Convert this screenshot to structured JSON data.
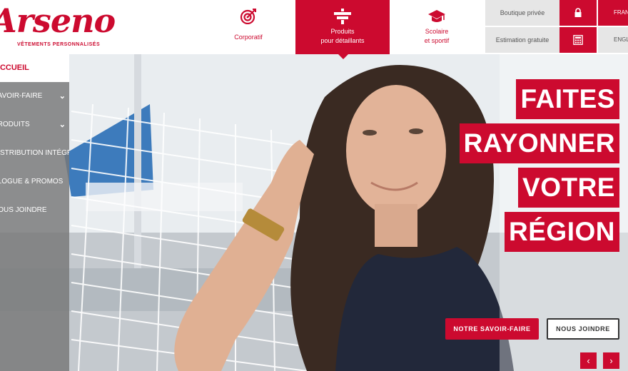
{
  "brand": {
    "logo_text": "Arseno",
    "tagline": "VÊTEMENTS PERSONNALISÉS",
    "accent": "#cc0a2f"
  },
  "nav": {
    "corporatif": "Corporatif",
    "produits_1": "Produits",
    "produits_2": "pour détaillants",
    "scolaire_1": "Scolaire",
    "scolaire_2": "et sportif"
  },
  "utility": {
    "boutique": "Boutique privée",
    "estimation": "Estimation gratuite",
    "lang_fr": "FRANÇAIS",
    "lang_en": "ENGLISH",
    "icons": [
      "lock-icon",
      "calculator-icon"
    ]
  },
  "side_menu": {
    "home": "ACCUEIL",
    "items": [
      {
        "label": "SAVOIR-FAIRE",
        "chevron": "⌄"
      },
      {
        "label": "PRODUITS",
        "chevron": "⌄"
      },
      {
        "label": "DISTRIBUTION INTÉGRÉE",
        "chevron": ""
      },
      {
        "label": "BLOGUE & PROMOS",
        "chevron": ""
      },
      {
        "label": "NOUS JOINDRE",
        "chevron": ""
      }
    ]
  },
  "hero": {
    "lines": [
      "FAITES",
      "RAYONNER",
      "VOTRE",
      "RÉGION"
    ],
    "cta_primary": "NOTRE SAVOIR-FAIRE",
    "cta_secondary": "NOUS JOINDRE",
    "prev": "‹",
    "next": "›"
  }
}
